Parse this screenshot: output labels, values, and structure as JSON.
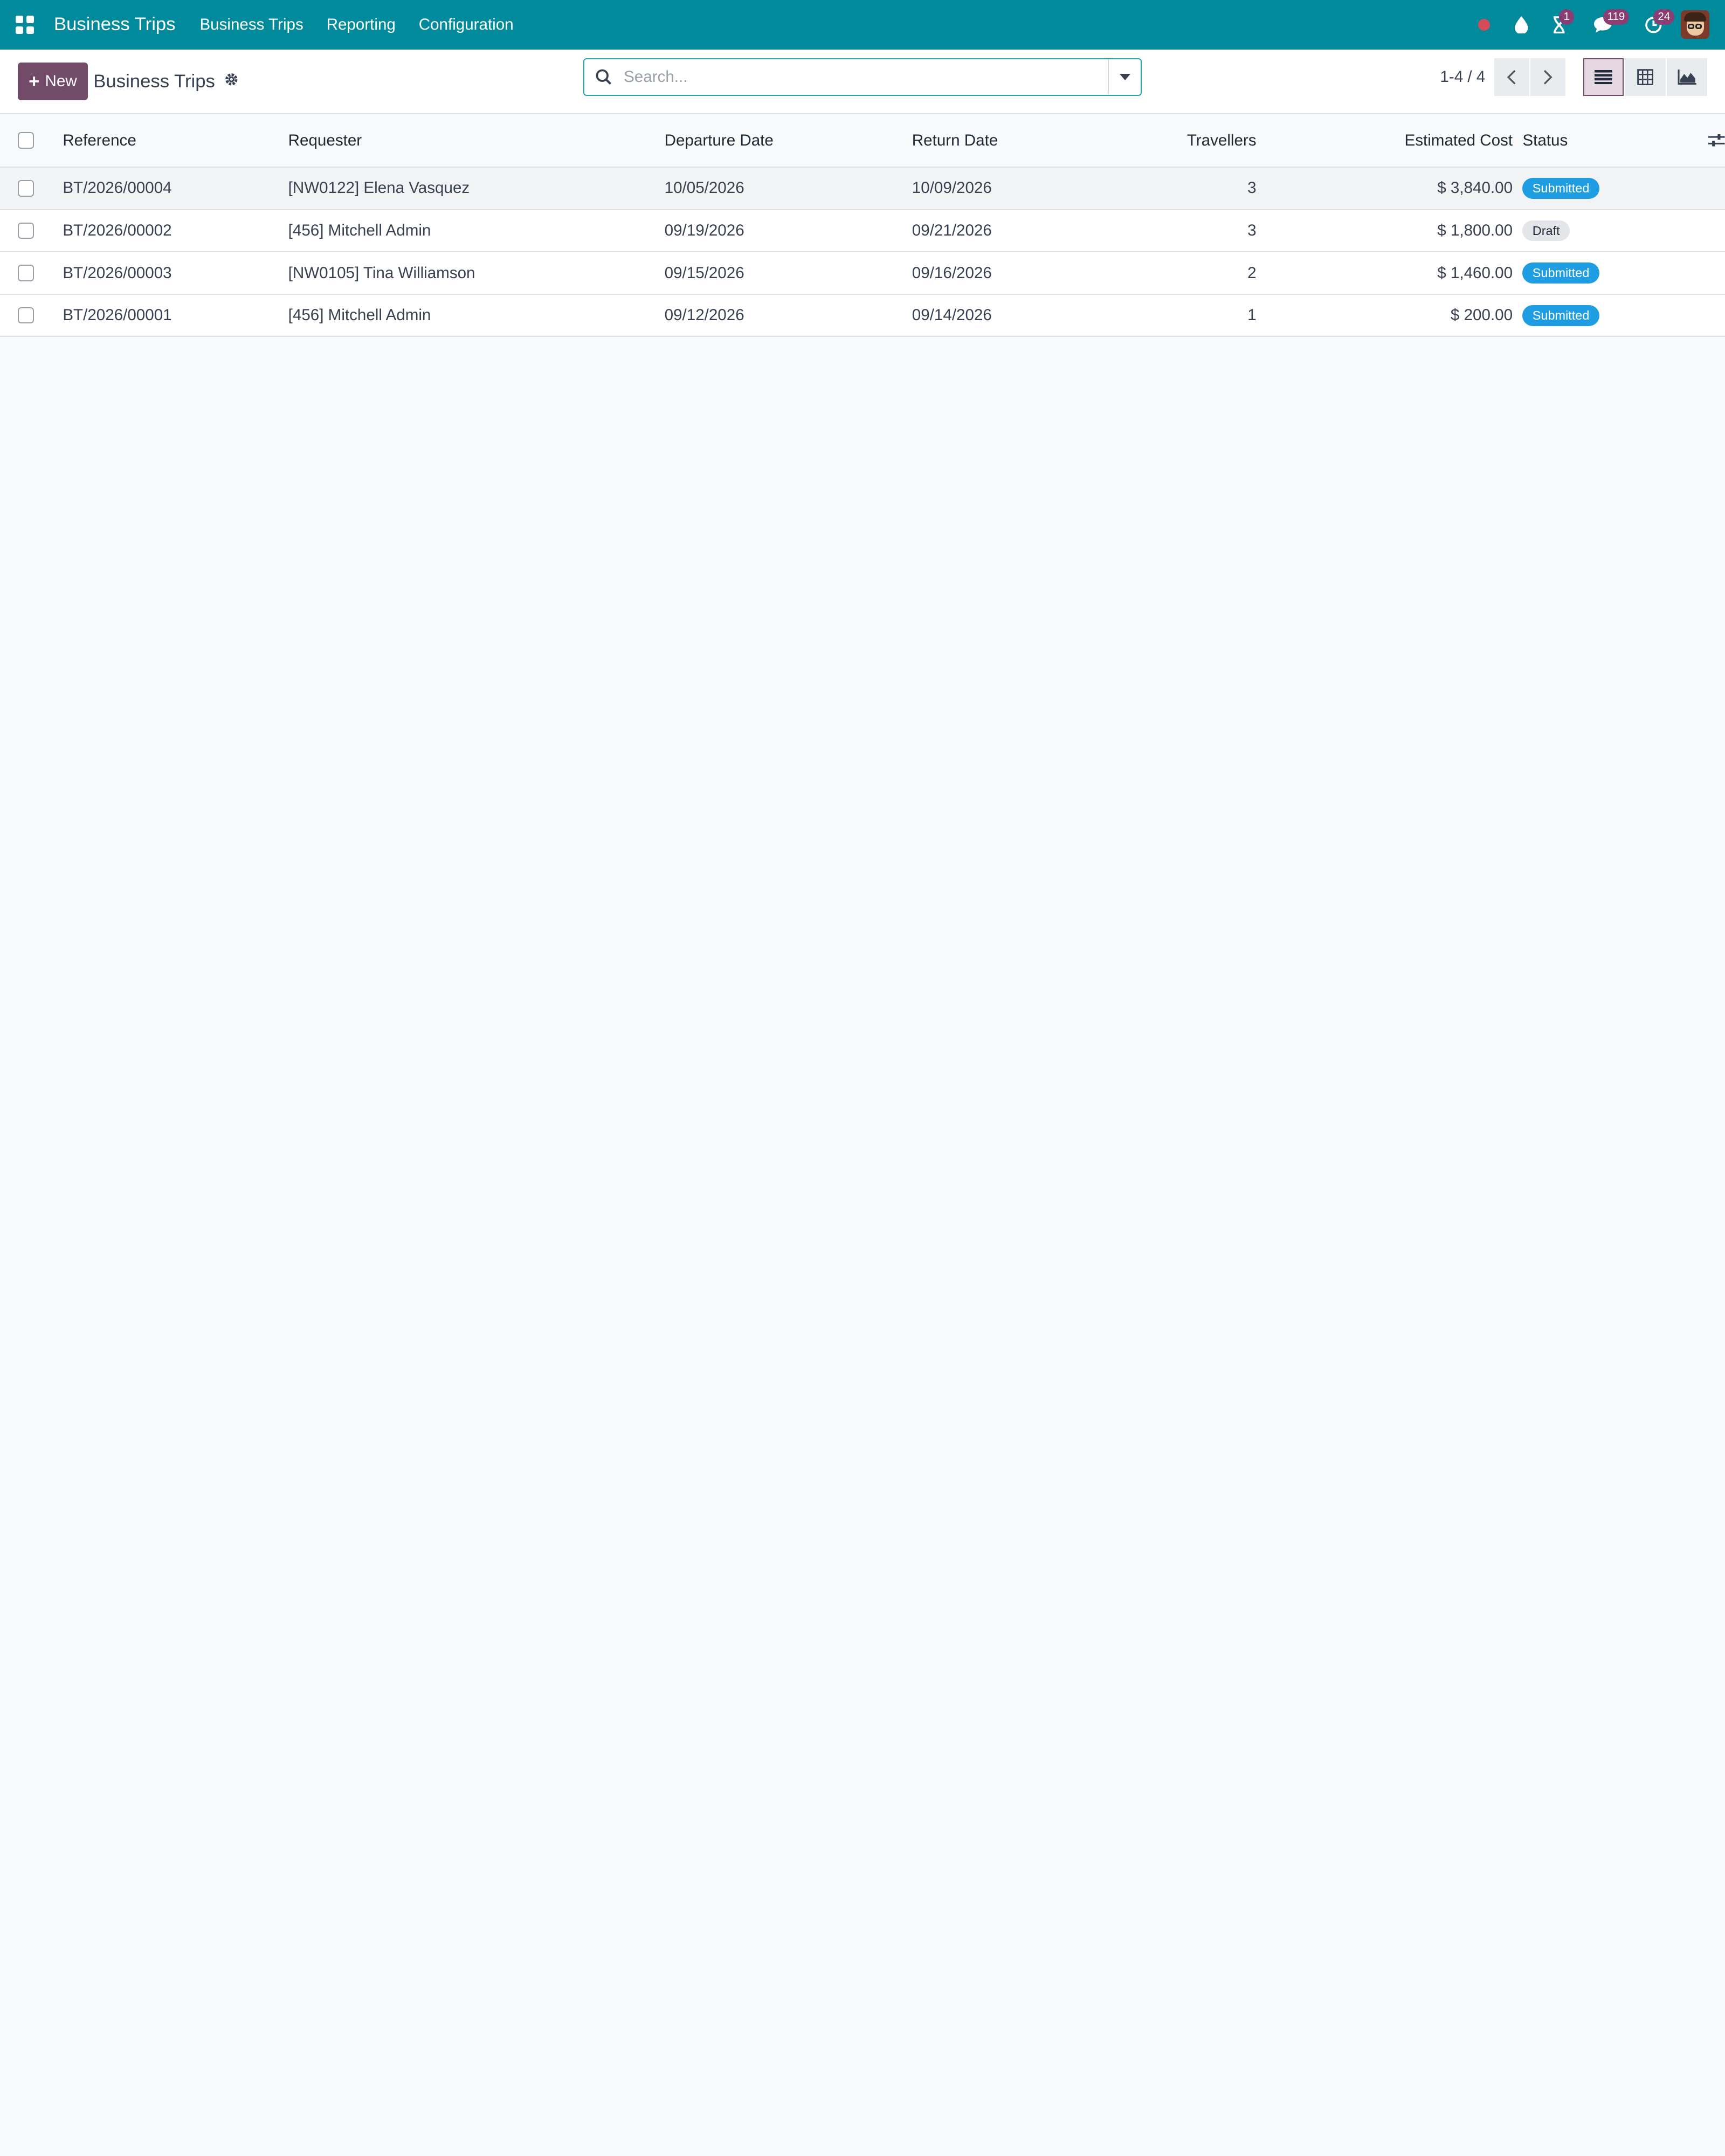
{
  "navbar": {
    "brand": "Business Trips",
    "menu": [
      {
        "label": "Business Trips"
      },
      {
        "label": "Reporting"
      },
      {
        "label": "Configuration"
      }
    ],
    "activity_badge": "1",
    "messages_badge": "119",
    "clock_badge": "24",
    "bg_color": "#018a9b"
  },
  "control": {
    "new_label": "New",
    "title": "Business Trips",
    "search_placeholder": "Search...",
    "pager": "1-4 / 4",
    "accent_color": "#714b67"
  },
  "table": {
    "headers": {
      "reference": "Reference",
      "requester": "Requester",
      "departure": "Departure Date",
      "return": "Return Date",
      "travellers": "Travellers",
      "cost": "Estimated Cost",
      "status": "Status"
    },
    "rows": [
      {
        "reference": "BT/2026/00004",
        "requester": "[NW0122] Elena Vasquez",
        "departure": "10/05/2026",
        "return": "10/09/2026",
        "travellers": "3",
        "cost": "$ 3,840.00",
        "status": "Submitted"
      },
      {
        "reference": "BT/2026/00002",
        "requester": "[456] Mitchell Admin",
        "departure": "09/19/2026",
        "return": "09/21/2026",
        "travellers": "3",
        "cost": "$ 1,800.00",
        "status": "Draft"
      },
      {
        "reference": "BT/2026/00003",
        "requester": "[NW0105] Tina Williamson",
        "departure": "09/15/2026",
        "return": "09/16/2026",
        "travellers": "2",
        "cost": "$ 1,460.00",
        "status": "Submitted"
      },
      {
        "reference": "BT/2026/00001",
        "requester": "[456] Mitchell Admin",
        "departure": "09/12/2026",
        "return": "09/14/2026",
        "travellers": "1",
        "cost": "$ 200.00",
        "status": "Submitted"
      }
    ],
    "status_colors": {
      "Submitted": "#1e9de3",
      "Draft": "#e3e5e8"
    }
  }
}
